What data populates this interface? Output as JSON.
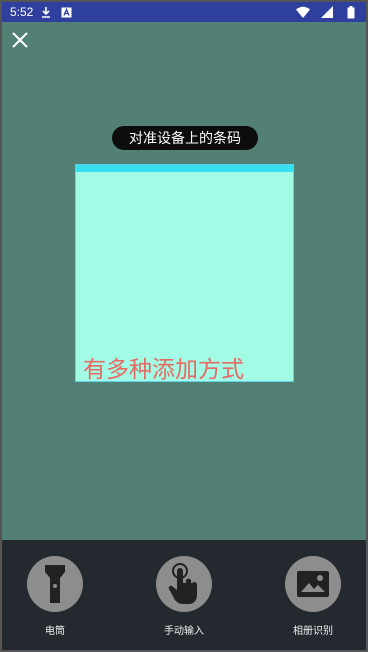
{
  "status_bar": {
    "time": "5:52",
    "icons": [
      "download-icon",
      "app-a-icon",
      "wifi-icon",
      "signal-icon",
      "battery-icon"
    ]
  },
  "scanner": {
    "close_icon": "close-icon",
    "hint": "对准设备上的条码",
    "caption": "有多种添加方式"
  },
  "tools": [
    {
      "label": "电筒",
      "icon": "flashlight-icon"
    },
    {
      "label": "手动输入",
      "icon": "hand-tap-icon"
    },
    {
      "label": "相册识别",
      "icon": "photo-icon"
    }
  ],
  "colors": {
    "scanner_bg": "#538075",
    "scan_frame": "#a3fbe6",
    "scan_line": "#37dff2",
    "caption": "#e66a63",
    "bottom_bar": "#24282f",
    "status_bar": "#2f3f9e"
  }
}
